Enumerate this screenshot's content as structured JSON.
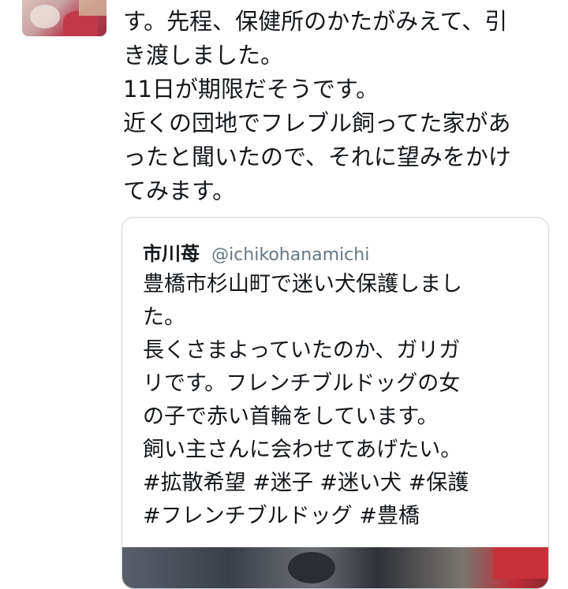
{
  "tweet": {
    "avatar_icon": "user-avatar-photo",
    "lines": [
      "す。先程、保健所のかたがみえて、引",
      "き渡しました。",
      "11日が期限だそうです。",
      "近くの団地でフレブル飼ってた家があ",
      "ったと聞いたので、それに望みをかけ",
      "てみます。"
    ]
  },
  "quote": {
    "name": "市川苺",
    "handle": "@ichikohanamichi",
    "lines": [
      "豊橋市杉山町で迷い犬保護しまし",
      "た。",
      "長くさまよっていたのか、ガリガ",
      "リです。フレンチブルドッグの女",
      "の子で赤い首輪をしています。",
      "飼い主さんに会わせてあげたい。",
      "#拡散希望  #迷子 #迷い犬 #保護",
      "#フレンチブルドッグ #豊橋"
    ],
    "media_description": "dog-photo"
  },
  "colors": {
    "text": "#14171a",
    "handle": "#657786",
    "card_border": "#ccd6dd"
  }
}
